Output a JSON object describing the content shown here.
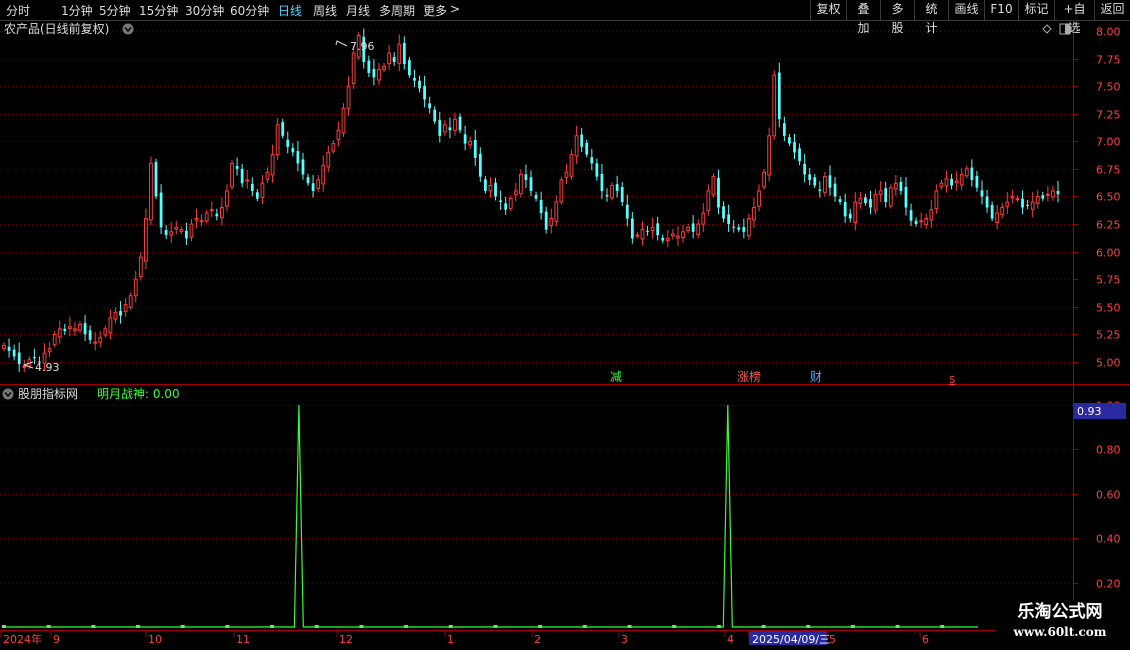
{
  "toolbar": {
    "periods": [
      "分时",
      "1分钟",
      "5分钟",
      "15分钟",
      "30分钟",
      "60分钟",
      "日线",
      "周线",
      "月线",
      "多周期",
      "更多"
    ],
    "active_period": "日线",
    "more_glyph": ">",
    "right_buttons": [
      "复权",
      "叠加",
      "多股",
      "统计",
      "画线",
      "F10",
      "标记",
      "+自选",
      "返回"
    ]
  },
  "main_chart": {
    "title": "农产品(日线前复权)",
    "high_label": "7.96",
    "low_label": "4.93",
    "event_markers": [
      {
        "text": "减",
        "color": "#33ff33"
      },
      {
        "text": "涨榜",
        "color": "#ff5555"
      },
      {
        "text": "财",
        "color": "#55aaff"
      },
      {
        "text": "s",
        "color": "#ff3333"
      }
    ]
  },
  "indicator": {
    "name": "股朋指标网",
    "line_label": "明月战神: 0.00",
    "current_value_label": "0.93"
  },
  "x_axis": {
    "labels": [
      "2024年",
      "9",
      "10",
      "11",
      "12",
      "1",
      "2",
      "3",
      "4",
      "2025/04/09/三",
      "5",
      "6"
    ]
  },
  "watermark": {
    "title": "乐淘公式网",
    "url": "www.60lt.com"
  },
  "colors": {
    "up": "#ff3b3b",
    "down": "#54ffff",
    "grid": "#7a0000",
    "border": "#a00000",
    "indicator_line": "#33ff33",
    "active_tab": "#4fd7ff"
  },
  "chart_data": [
    {
      "type": "candlestick",
      "title": "农产品(日线前复权)",
      "ylim": [
        4.8,
        8.1
      ],
      "y_ticks": [
        5.0,
        5.25,
        5.5,
        5.75,
        6.0,
        6.25,
        6.5,
        6.75,
        7.0,
        7.25,
        7.5,
        7.75,
        8.0
      ],
      "x_labels": [
        "9",
        "10",
        "11",
        "12",
        "1",
        "2",
        "3",
        "4",
        "5",
        "6"
      ],
      "close": [
        5.15,
        5.1,
        5.05,
        4.98,
        4.96,
        5.02,
        5.04,
        5.0,
        5.08,
        5.12,
        5.25,
        5.3,
        5.28,
        5.32,
        5.3,
        5.34,
        5.25,
        5.2,
        5.18,
        5.22,
        5.3,
        5.4,
        5.45,
        5.42,
        5.52,
        5.6,
        5.75,
        5.95,
        6.3,
        6.8,
        6.5,
        6.22,
        6.15,
        6.18,
        6.22,
        6.2,
        6.12,
        6.25,
        6.3,
        6.28,
        6.35,
        6.38,
        6.32,
        6.4,
        6.55,
        6.8,
        6.75,
        6.62,
        6.65,
        6.55,
        6.48,
        6.62,
        6.72,
        6.88,
        7.15,
        7.05,
        6.95,
        6.9,
        6.8,
        6.7,
        6.62,
        6.55,
        6.65,
        6.78,
        6.9,
        6.98,
        7.1,
        7.3,
        7.5,
        7.8,
        7.96,
        7.72,
        7.62,
        7.58,
        7.65,
        7.68,
        7.8,
        7.72,
        7.88,
        7.7,
        7.6,
        7.55,
        7.48,
        7.38,
        7.3,
        7.18,
        7.05,
        7.15,
        7.1,
        7.2,
        7.1,
        6.98,
        7.0,
        6.85,
        6.68,
        6.55,
        6.6,
        6.5,
        6.45,
        6.38,
        6.48,
        6.55,
        6.7,
        6.65,
        6.55,
        6.48,
        6.35,
        6.2,
        6.3,
        6.45,
        6.65,
        6.72,
        6.88,
        7.05,
        6.95,
        6.88,
        6.8,
        6.68,
        6.55,
        6.5,
        6.6,
        6.55,
        6.45,
        6.3,
        6.12,
        6.15,
        6.2,
        6.18,
        6.22,
        6.15,
        6.1,
        6.12,
        6.16,
        6.14,
        6.18,
        6.22,
        6.18,
        6.25,
        6.35,
        6.55,
        6.68,
        6.4,
        6.3,
        6.25,
        6.22,
        6.2,
        6.18,
        6.3,
        6.4,
        6.55,
        6.72,
        7.05,
        7.6,
        7.2,
        7.05,
        6.98,
        6.9,
        6.82,
        6.7,
        6.65,
        6.6,
        6.55,
        6.68,
        6.58,
        6.5,
        6.45,
        6.32,
        6.3,
        6.45,
        6.48,
        6.44,
        6.4,
        6.52,
        6.55,
        6.45,
        6.58,
        6.62,
        6.55,
        6.4,
        6.28,
        6.25,
        6.28,
        6.3,
        6.38,
        6.55,
        6.62,
        6.66,
        6.6,
        6.64,
        6.7,
        6.75,
        6.65,
        6.58,
        6.5,
        6.4,
        6.3,
        6.35,
        6.4,
        6.45,
        6.5,
        6.48,
        6.4,
        6.42,
        6.45,
        6.5,
        6.48,
        6.52,
        6.55,
        6.52
      ]
    },
    {
      "type": "line",
      "name": "明月战神",
      "ylim": [
        0,
        1.0
      ],
      "y_ticks": [
        0.2,
        0.4,
        0.6,
        0.8,
        1.0
      ],
      "values": [
        0,
        0,
        0,
        0,
        0,
        0,
        0,
        0,
        0,
        0,
        0,
        0,
        0,
        0,
        0,
        0,
        0,
        0,
        0,
        0,
        0,
        0,
        0,
        0,
        0,
        0,
        0,
        0,
        0,
        0,
        0,
        0,
        0,
        0,
        0,
        0,
        0,
        0,
        0,
        0,
        0,
        0,
        0,
        0,
        0,
        0,
        0,
        0,
        0,
        0,
        0,
        0,
        0,
        0,
        0,
        0,
        0,
        0,
        0,
        0,
        0,
        0,
        0,
        0,
        0,
        0,
        1,
        0,
        0,
        0,
        0,
        0,
        0,
        0,
        0,
        0,
        0,
        0,
        0,
        0,
        0,
        0,
        0,
        0,
        0,
        0,
        0,
        0,
        0,
        0,
        0,
        0,
        0,
        0,
        0,
        0,
        0,
        0,
        0,
        0,
        0,
        0,
        0,
        0,
        0,
        0,
        0,
        0,
        0,
        0,
        0,
        0,
        0,
        0,
        0,
        0,
        0,
        0,
        0,
        0,
        0,
        0,
        0,
        0,
        0,
        0,
        0,
        0,
        0,
        0,
        0,
        0,
        0,
        0,
        0,
        0,
        0,
        0,
        0,
        0,
        0,
        0,
        0,
        0,
        0,
        0,
        0,
        0,
        0,
        0,
        0,
        0,
        0,
        0,
        0,
        0,
        0,
        0,
        0,
        0,
        0,
        0,
        1,
        0,
        0,
        0,
        0,
        0,
        0,
        0,
        0,
        0,
        0,
        0,
        0,
        0,
        0,
        0,
        0,
        0,
        0,
        0,
        0,
        0,
        0,
        0,
        0,
        0,
        0,
        0,
        0,
        0,
        0,
        0,
        0,
        0,
        0,
        0,
        0,
        0,
        0,
        0,
        0,
        0,
        0,
        0,
        0,
        0,
        0,
        0,
        0,
        0,
        0,
        0,
        0,
        0,
        0,
        0,
        0
      ]
    }
  ]
}
